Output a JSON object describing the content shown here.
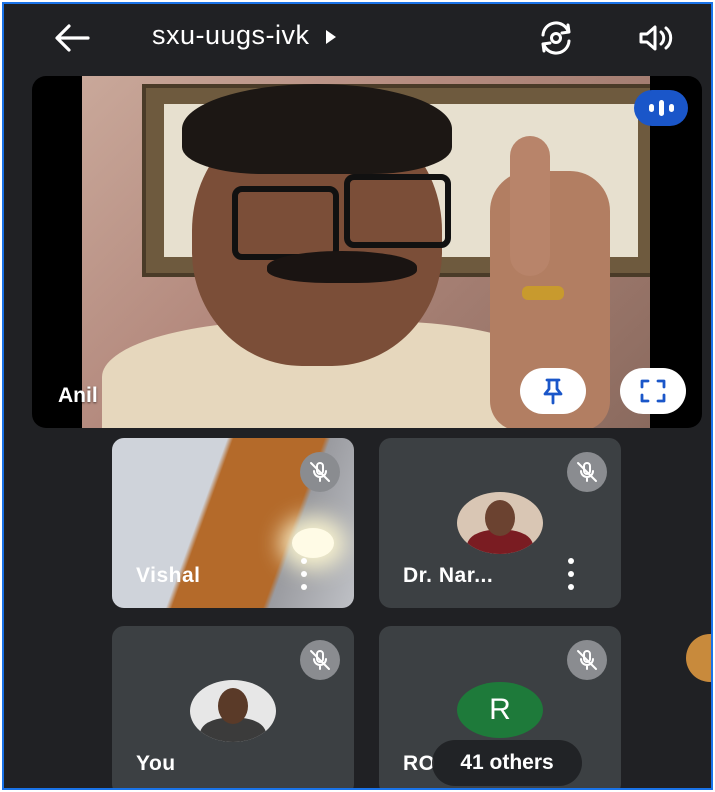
{
  "meeting": {
    "code": "sxu-uugs-ivk"
  },
  "main_tile": {
    "participant_name": "Anil"
  },
  "tiles": [
    {
      "name": "Vishal",
      "muted": true,
      "has_video": true
    },
    {
      "name": "Dr. Nar...",
      "muted": true,
      "has_video": false,
      "avatar": "photo"
    },
    {
      "name": "You",
      "muted": true,
      "has_video": false,
      "avatar": "photo"
    },
    {
      "name": "RO",
      "muted": true,
      "has_video": false,
      "avatar_letter": "R"
    }
  ],
  "others_label": "41 others",
  "colors": {
    "background": "#202124",
    "tile": "#3c4043",
    "accent_blue": "#1a56c9",
    "avatar_green": "#1e7a3a"
  },
  "icons": [
    "back-arrow-icon",
    "switch-camera-icon",
    "speaker-icon",
    "audio-level-icon",
    "pin-icon",
    "fullscreen-icon",
    "mic-off-icon",
    "more-vert-icon"
  ]
}
